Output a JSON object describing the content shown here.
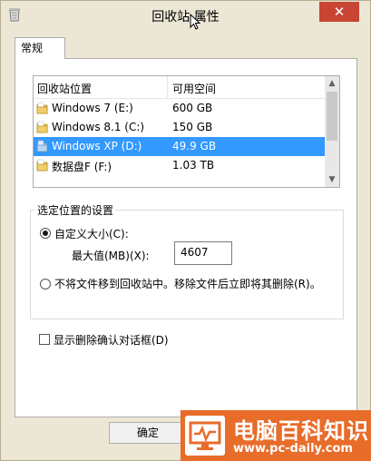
{
  "window": {
    "title": "回收站 属性",
    "close_label": "✕"
  },
  "tab": {
    "label": "常规"
  },
  "list": {
    "headers": [
      "回收站位置",
      "可用空间"
    ],
    "rows": [
      {
        "name": "Windows 7 (E:)",
        "space": "600 GB",
        "selected": false
      },
      {
        "name": "Windows 8.1 (C:)",
        "space": "150 GB",
        "selected": false
      },
      {
        "name": "Windows XP (D:)",
        "space": "49.9 GB",
        "selected": true
      },
      {
        "name": "数据盘F (F:)",
        "space": "1.03 TB",
        "selected": false
      }
    ]
  },
  "settings": {
    "group_title": "选定位置的设置",
    "custom_size_label": "自定义大小(C):",
    "max_label": "最大值(MB)(X):",
    "max_value": "4607",
    "no_move_label": "不将文件移到回收站中。移除文件后立即将其删除(R)。"
  },
  "confirm_dialog_label": "显示删除确认对话框(D)",
  "buttons": {
    "ok": "确定"
  },
  "watermark": {
    "name": "电脑百科知识",
    "url": "www.pc-daily.com"
  },
  "colors": {
    "selection": "#3399ff",
    "close_button": "#c74532",
    "watermark_bg": "#e86c2a"
  }
}
